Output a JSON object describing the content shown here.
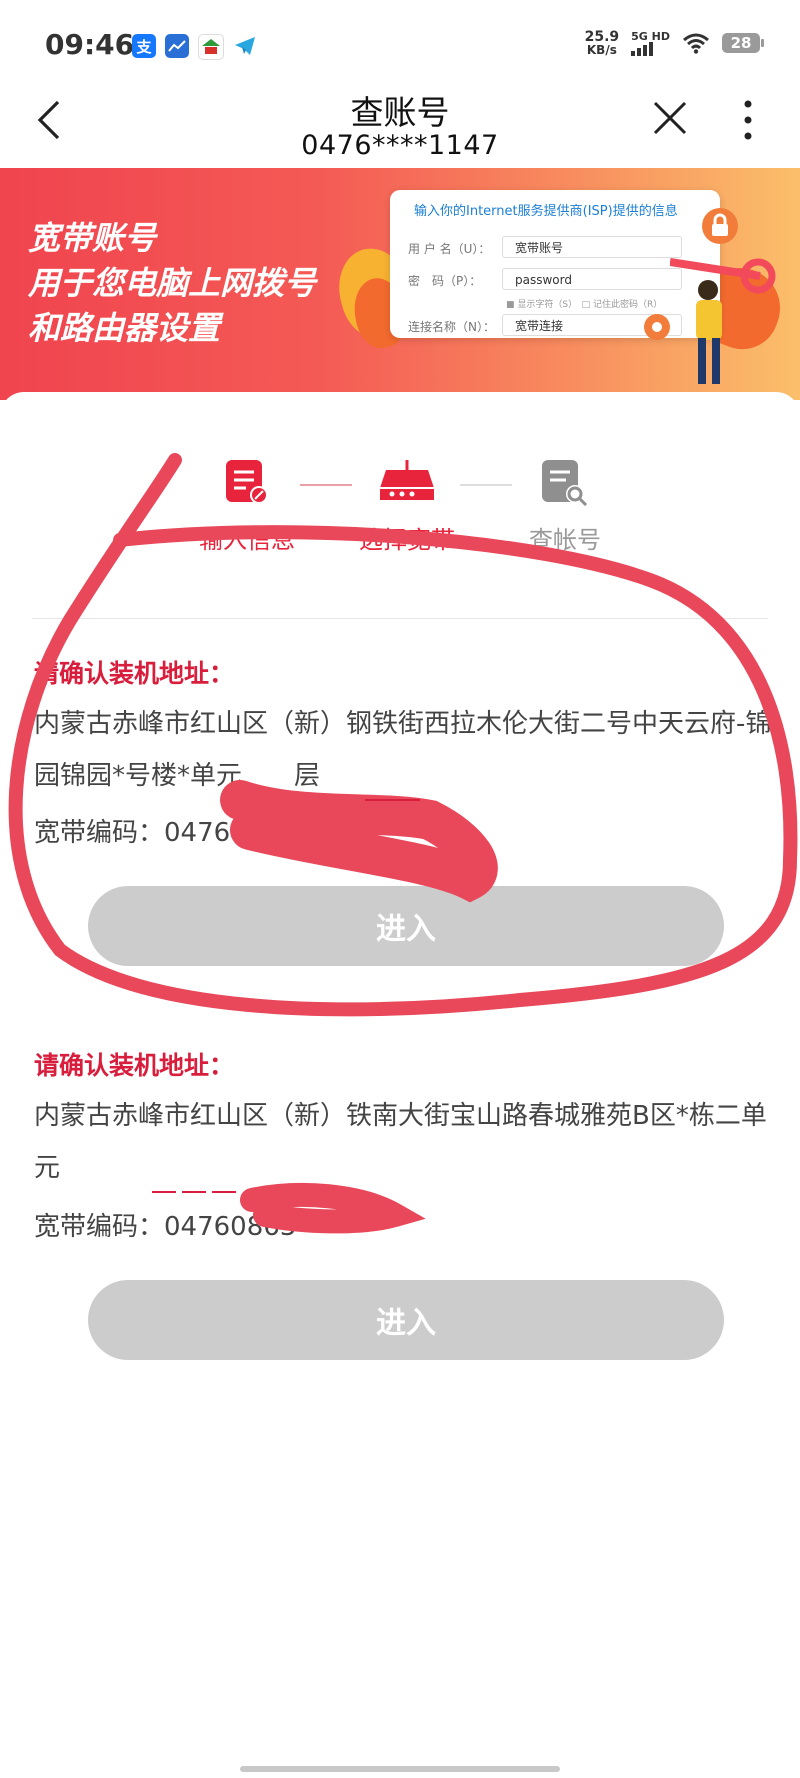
{
  "status": {
    "time": "09:46",
    "net_speed_value": "25.9",
    "net_speed_unit": "KB/s",
    "network": "5G HD",
    "battery": "28",
    "app_icons": [
      "alipay-icon",
      "chart-app-icon",
      "bank-icon",
      "telegram-icon"
    ],
    "alipay_glyph": "支"
  },
  "nav": {
    "title": "查账号",
    "subtitle": "0476****1147"
  },
  "banner": {
    "lines": [
      "宽带账号",
      "用于您电脑上网拨号",
      "和路由器设置"
    ],
    "isp_card": {
      "heading": "输入你的Internet服务提供商(ISP)提供的信息",
      "username_label": "用 户 名（U）：",
      "username_value": "宽带账号",
      "password_label": "密　码（P）：",
      "password_value": "password",
      "show_chars": "显示字符（S）",
      "remember_pwd": "记住此密码（R）",
      "conn_name_label": "连接名称（N）：",
      "conn_name_value": "宽带连接"
    }
  },
  "steps": [
    {
      "label": "输入信息",
      "state": "done"
    },
    {
      "label": "选择宽带",
      "state": "active"
    },
    {
      "label": "查帐号",
      "state": "pending"
    }
  ],
  "addresses": [
    {
      "confirm_label": "请确认装机地址：",
      "address": "内蒙古赤峰市红山区（新）钢铁街西拉木伦大街二号中天云府-锦园锦园*号楼*单元　　层",
      "code_label": "宽带编码：",
      "code_value": "0476",
      "button": "进入"
    },
    {
      "confirm_label": "请确认装机地址：",
      "address": "内蒙古赤峰市红山区（新）铁南大街宝山路春城雅苑B区*栋二单元",
      "code_label": "宽带编码：",
      "code_value": "04760863",
      "button": "进入"
    }
  ],
  "colors": {
    "accent": "#d81e3c",
    "active_step": "#e8243c",
    "pending_step": "#999999",
    "button_disabled": "#cccccc",
    "scribble": "#e8485a"
  }
}
